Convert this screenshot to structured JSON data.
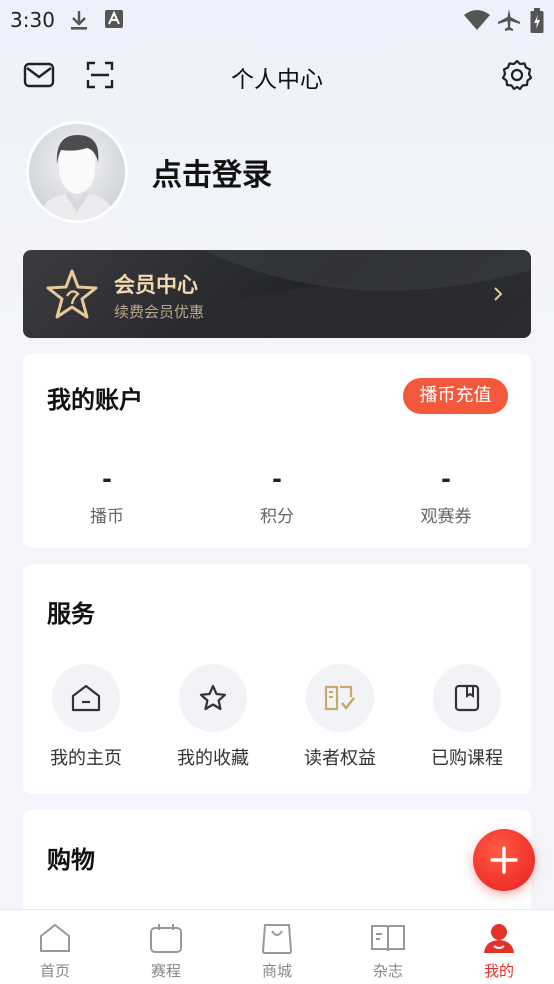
{
  "status_bar": {
    "time": "3:30"
  },
  "header": {
    "title": "个人中心"
  },
  "profile": {
    "login_text": "点击登录"
  },
  "vip": {
    "title": "会员中心",
    "subtitle": "续费会员优惠"
  },
  "account": {
    "title": "我的账户",
    "recharge_label": "播币充值",
    "stats": [
      {
        "value": "-",
        "label": "播币"
      },
      {
        "value": "-",
        "label": "积分"
      },
      {
        "value": "-",
        "label": "观赛券"
      }
    ]
  },
  "services": {
    "title": "服务",
    "items": [
      {
        "label": "我的主页",
        "icon": "home-icon"
      },
      {
        "label": "我的收藏",
        "icon": "star-icon"
      },
      {
        "label": "读者权益",
        "icon": "reader-rights-icon"
      },
      {
        "label": "已购课程",
        "icon": "purchased-course-icon"
      }
    ]
  },
  "shopping": {
    "title": "购物"
  },
  "tabbar": {
    "items": [
      {
        "label": "首页",
        "icon": "home-tab-icon"
      },
      {
        "label": "赛程",
        "icon": "schedule-icon"
      },
      {
        "label": "商城",
        "icon": "shop-bag-icon"
      },
      {
        "label": "杂志",
        "icon": "magazine-icon"
      },
      {
        "label": "我的",
        "icon": "profile-icon",
        "active": true
      }
    ]
  },
  "colors": {
    "accent": "#f2593c",
    "tab_active": "#e4322a",
    "vip_gold": "#f2d9b0"
  }
}
